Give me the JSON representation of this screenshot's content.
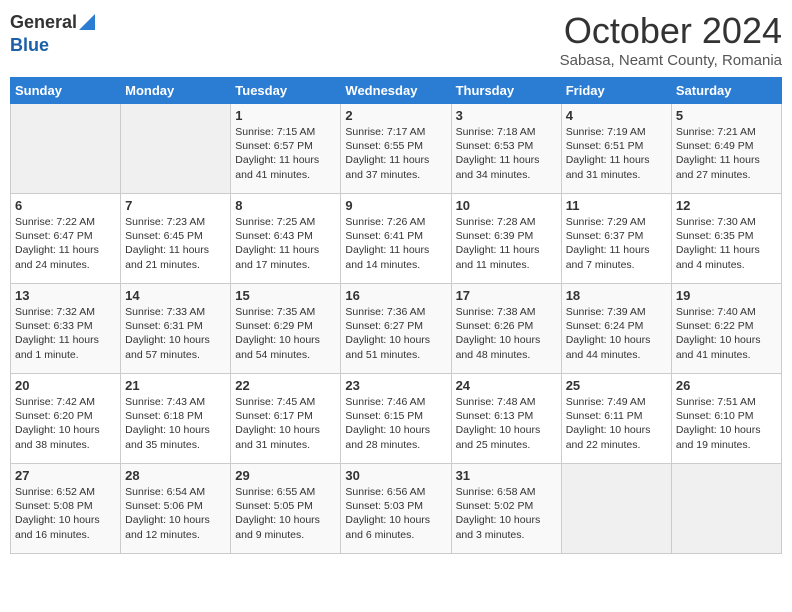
{
  "header": {
    "logo_general": "General",
    "logo_blue": "Blue",
    "month_title": "October 2024",
    "location": "Sabasa, Neamt County, Romania"
  },
  "days_of_week": [
    "Sunday",
    "Monday",
    "Tuesday",
    "Wednesday",
    "Thursday",
    "Friday",
    "Saturday"
  ],
  "weeks": [
    [
      {
        "day": "",
        "info": ""
      },
      {
        "day": "",
        "info": ""
      },
      {
        "day": "1",
        "info": "Sunrise: 7:15 AM\nSunset: 6:57 PM\nDaylight: 11 hours and 41 minutes."
      },
      {
        "day": "2",
        "info": "Sunrise: 7:17 AM\nSunset: 6:55 PM\nDaylight: 11 hours and 37 minutes."
      },
      {
        "day": "3",
        "info": "Sunrise: 7:18 AM\nSunset: 6:53 PM\nDaylight: 11 hours and 34 minutes."
      },
      {
        "day": "4",
        "info": "Sunrise: 7:19 AM\nSunset: 6:51 PM\nDaylight: 11 hours and 31 minutes."
      },
      {
        "day": "5",
        "info": "Sunrise: 7:21 AM\nSunset: 6:49 PM\nDaylight: 11 hours and 27 minutes."
      }
    ],
    [
      {
        "day": "6",
        "info": "Sunrise: 7:22 AM\nSunset: 6:47 PM\nDaylight: 11 hours and 24 minutes."
      },
      {
        "day": "7",
        "info": "Sunrise: 7:23 AM\nSunset: 6:45 PM\nDaylight: 11 hours and 21 minutes."
      },
      {
        "day": "8",
        "info": "Sunrise: 7:25 AM\nSunset: 6:43 PM\nDaylight: 11 hours and 17 minutes."
      },
      {
        "day": "9",
        "info": "Sunrise: 7:26 AM\nSunset: 6:41 PM\nDaylight: 11 hours and 14 minutes."
      },
      {
        "day": "10",
        "info": "Sunrise: 7:28 AM\nSunset: 6:39 PM\nDaylight: 11 hours and 11 minutes."
      },
      {
        "day": "11",
        "info": "Sunrise: 7:29 AM\nSunset: 6:37 PM\nDaylight: 11 hours and 7 minutes."
      },
      {
        "day": "12",
        "info": "Sunrise: 7:30 AM\nSunset: 6:35 PM\nDaylight: 11 hours and 4 minutes."
      }
    ],
    [
      {
        "day": "13",
        "info": "Sunrise: 7:32 AM\nSunset: 6:33 PM\nDaylight: 11 hours and 1 minute."
      },
      {
        "day": "14",
        "info": "Sunrise: 7:33 AM\nSunset: 6:31 PM\nDaylight: 10 hours and 57 minutes."
      },
      {
        "day": "15",
        "info": "Sunrise: 7:35 AM\nSunset: 6:29 PM\nDaylight: 10 hours and 54 minutes."
      },
      {
        "day": "16",
        "info": "Sunrise: 7:36 AM\nSunset: 6:27 PM\nDaylight: 10 hours and 51 minutes."
      },
      {
        "day": "17",
        "info": "Sunrise: 7:38 AM\nSunset: 6:26 PM\nDaylight: 10 hours and 48 minutes."
      },
      {
        "day": "18",
        "info": "Sunrise: 7:39 AM\nSunset: 6:24 PM\nDaylight: 10 hours and 44 minutes."
      },
      {
        "day": "19",
        "info": "Sunrise: 7:40 AM\nSunset: 6:22 PM\nDaylight: 10 hours and 41 minutes."
      }
    ],
    [
      {
        "day": "20",
        "info": "Sunrise: 7:42 AM\nSunset: 6:20 PM\nDaylight: 10 hours and 38 minutes."
      },
      {
        "day": "21",
        "info": "Sunrise: 7:43 AM\nSunset: 6:18 PM\nDaylight: 10 hours and 35 minutes."
      },
      {
        "day": "22",
        "info": "Sunrise: 7:45 AM\nSunset: 6:17 PM\nDaylight: 10 hours and 31 minutes."
      },
      {
        "day": "23",
        "info": "Sunrise: 7:46 AM\nSunset: 6:15 PM\nDaylight: 10 hours and 28 minutes."
      },
      {
        "day": "24",
        "info": "Sunrise: 7:48 AM\nSunset: 6:13 PM\nDaylight: 10 hours and 25 minutes."
      },
      {
        "day": "25",
        "info": "Sunrise: 7:49 AM\nSunset: 6:11 PM\nDaylight: 10 hours and 22 minutes."
      },
      {
        "day": "26",
        "info": "Sunrise: 7:51 AM\nSunset: 6:10 PM\nDaylight: 10 hours and 19 minutes."
      }
    ],
    [
      {
        "day": "27",
        "info": "Sunrise: 6:52 AM\nSunset: 5:08 PM\nDaylight: 10 hours and 16 minutes."
      },
      {
        "day": "28",
        "info": "Sunrise: 6:54 AM\nSunset: 5:06 PM\nDaylight: 10 hours and 12 minutes."
      },
      {
        "day": "29",
        "info": "Sunrise: 6:55 AM\nSunset: 5:05 PM\nDaylight: 10 hours and 9 minutes."
      },
      {
        "day": "30",
        "info": "Sunrise: 6:56 AM\nSunset: 5:03 PM\nDaylight: 10 hours and 6 minutes."
      },
      {
        "day": "31",
        "info": "Sunrise: 6:58 AM\nSunset: 5:02 PM\nDaylight: 10 hours and 3 minutes."
      },
      {
        "day": "",
        "info": ""
      },
      {
        "day": "",
        "info": ""
      }
    ]
  ]
}
